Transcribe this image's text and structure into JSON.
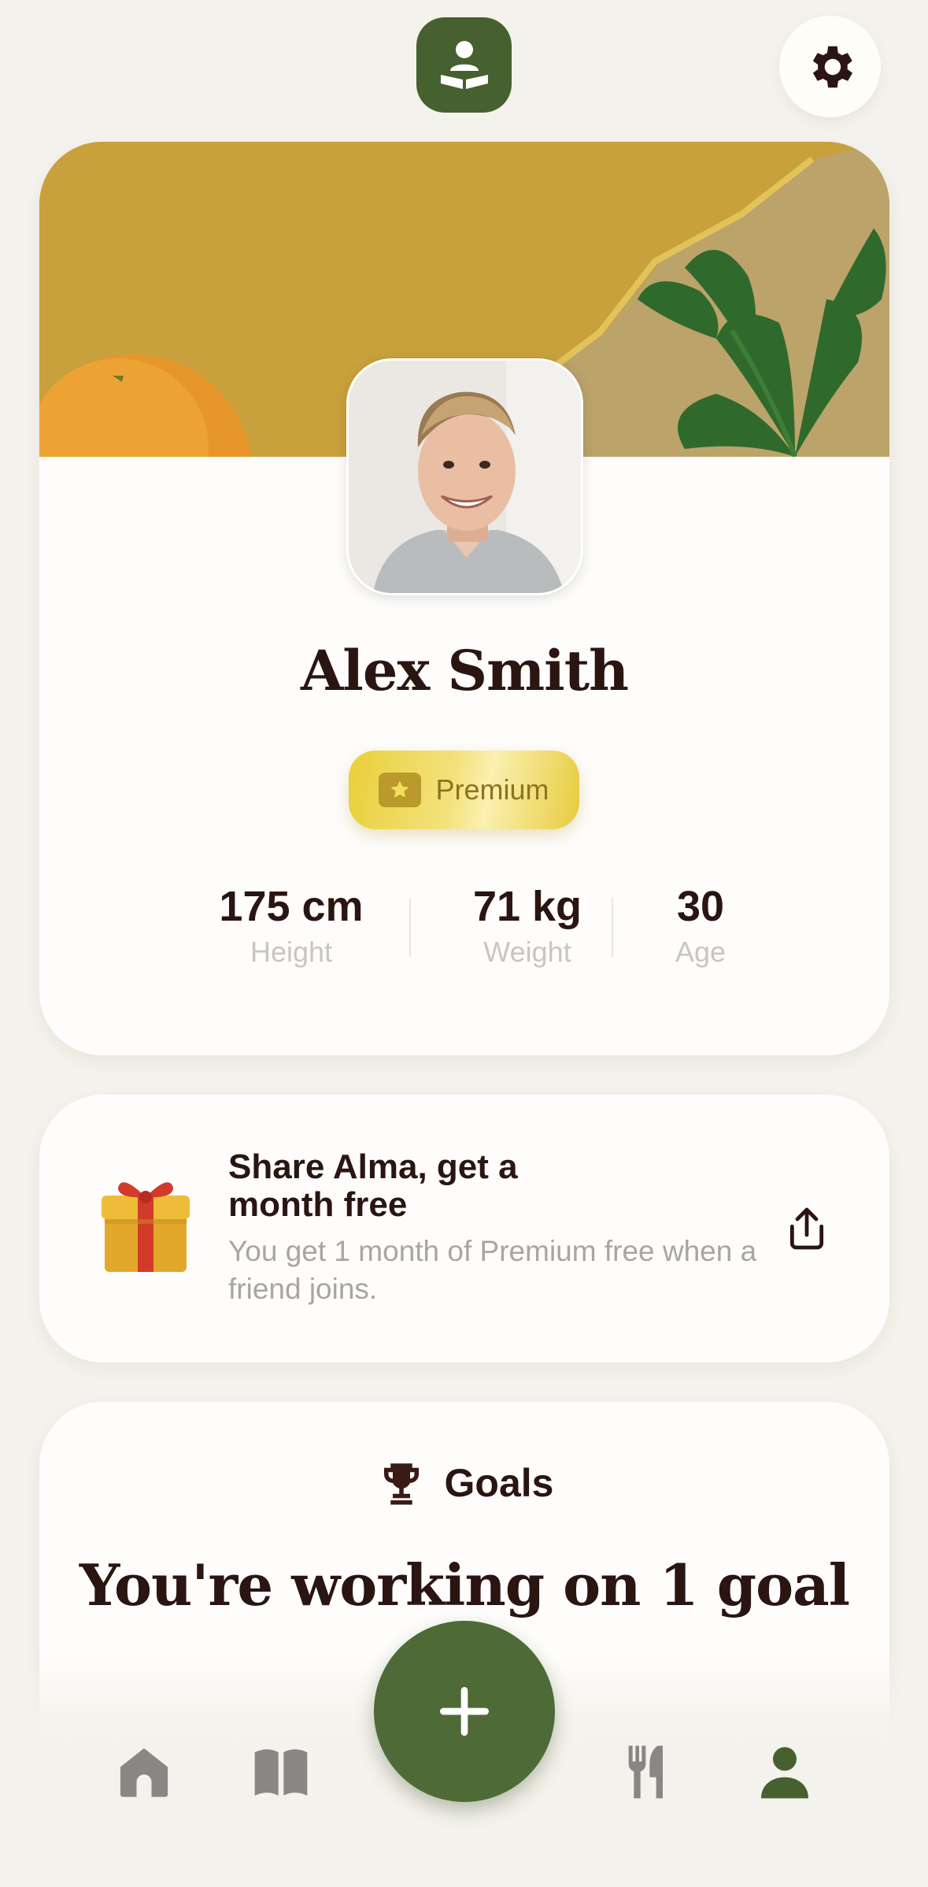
{
  "header": {
    "logo_icon": "reading-person-icon",
    "settings_icon": "gear-icon"
  },
  "profile": {
    "name": "Alex Smith",
    "badge": {
      "label": "Premium",
      "icon": "star-icon",
      "color": "#e9cf3a"
    },
    "stats": [
      {
        "value": "175 cm",
        "label": "Height"
      },
      {
        "value": "71 kg",
        "label": "Weight"
      },
      {
        "value": "30",
        "label": "Age"
      }
    ]
  },
  "share": {
    "title": "Share Alma, get a month free",
    "description": "You get 1 month of Premium free when a friend joins.",
    "icon": "gift-icon",
    "action_icon": "share-icon"
  },
  "goals": {
    "label": "Goals",
    "icon": "trophy-icon",
    "title": "You're working on 1 goal"
  },
  "nav": {
    "items": [
      {
        "icon": "home-icon"
      },
      {
        "icon": "book-icon"
      },
      {
        "icon": "plus-icon"
      },
      {
        "icon": "fork-knife-icon"
      },
      {
        "icon": "person-icon"
      }
    ]
  },
  "colors": {
    "brand_green": "#46602f",
    "text_dark": "#2a1512",
    "background": "#f4f2ec"
  }
}
